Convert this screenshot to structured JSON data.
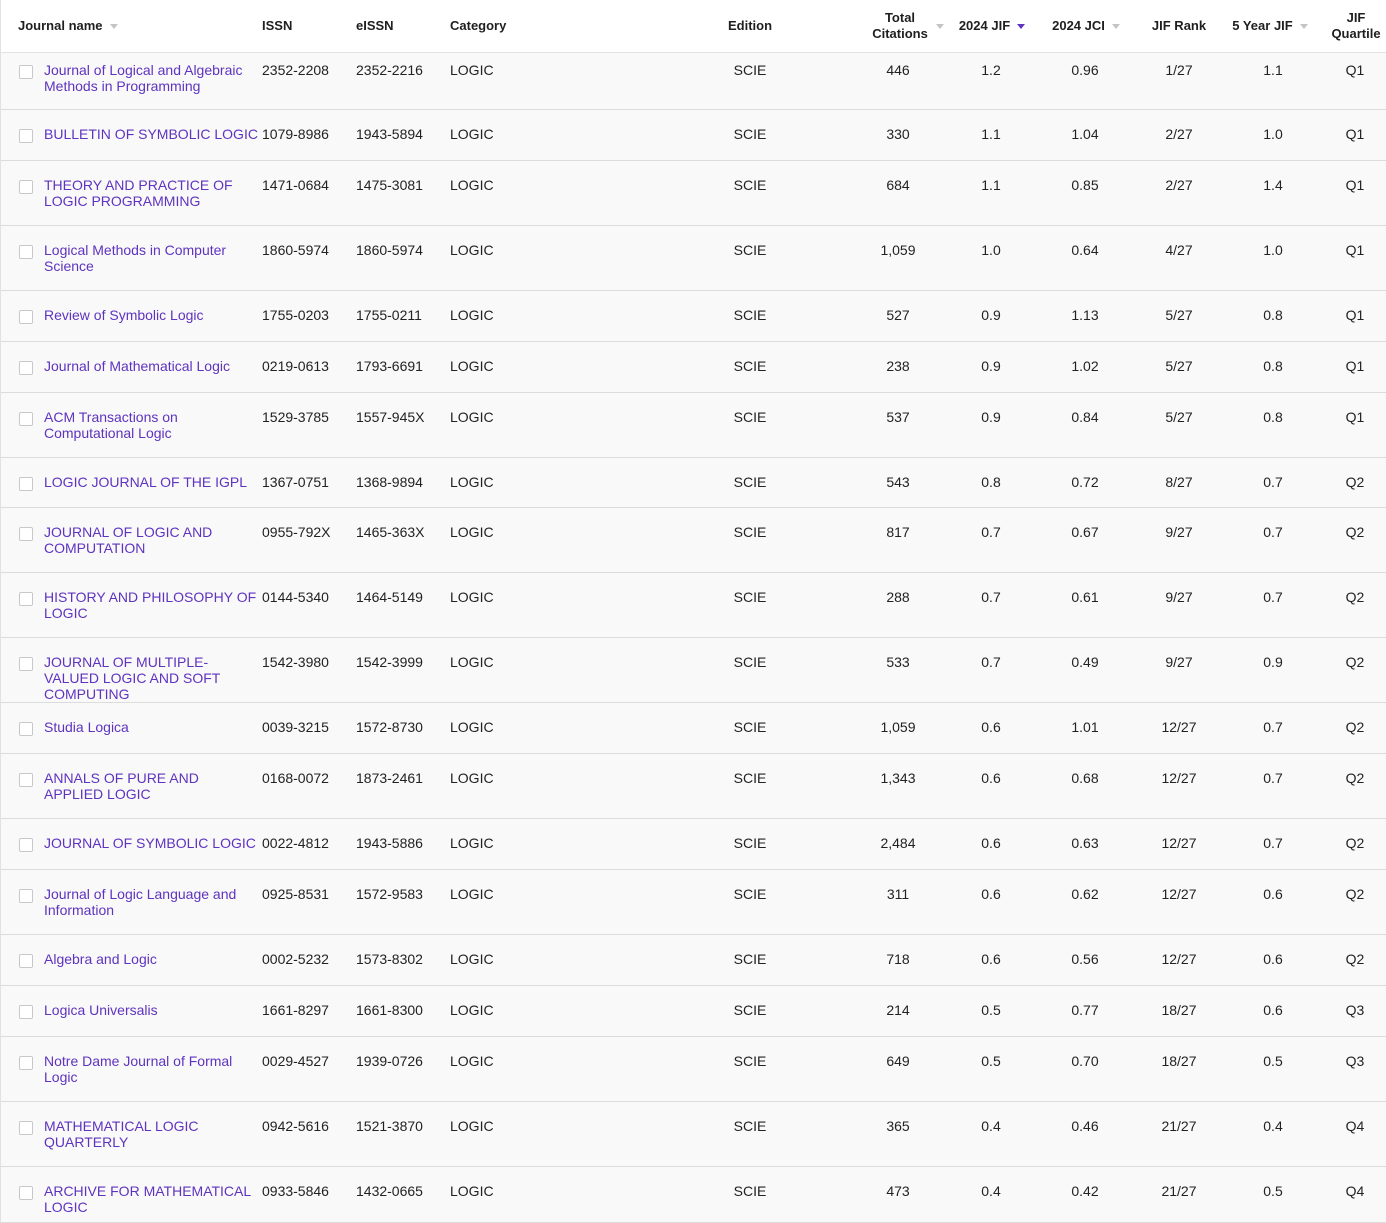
{
  "columns": {
    "journal_name": "Journal name",
    "issn": "ISSN",
    "eissn": "eISSN",
    "category": "Category",
    "edition": "Edition",
    "total_citations": "Total Citations",
    "jif": "2024 JIF",
    "jci": "2024 JCI",
    "jif_rank": "JIF Rank",
    "five_year_jif": "5 Year JIF",
    "jif_quartile": "JIF Quartile"
  },
  "rows": [
    {
      "name": "Journal of Logical and Algebraic Methods in Programming",
      "issn": "2352-2208",
      "eissn": "2352-2216",
      "category": "LOGIC",
      "edition": "SCIE",
      "citations": "446",
      "jif": "1.2",
      "jci": "0.96",
      "rank": "1/27",
      "jif5": "1.1",
      "quartile": "Q1"
    },
    {
      "name": "BULLETIN OF SYMBOLIC LOGIC",
      "issn": "1079-8986",
      "eissn": "1943-5894",
      "category": "LOGIC",
      "edition": "SCIE",
      "citations": "330",
      "jif": "1.1",
      "jci": "1.04",
      "rank": "2/27",
      "jif5": "1.0",
      "quartile": "Q1"
    },
    {
      "name": "THEORY AND PRACTICE OF LOGIC PROGRAMMING",
      "issn": "1471-0684",
      "eissn": "1475-3081",
      "category": "LOGIC",
      "edition": "SCIE",
      "citations": "684",
      "jif": "1.1",
      "jci": "0.85",
      "rank": "2/27",
      "jif5": "1.4",
      "quartile": "Q1"
    },
    {
      "name": "Logical Methods in Computer Science",
      "issn": "1860-5974",
      "eissn": "1860-5974",
      "category": "LOGIC",
      "edition": "SCIE",
      "citations": "1,059",
      "jif": "1.0",
      "jci": "0.64",
      "rank": "4/27",
      "jif5": "1.0",
      "quartile": "Q1"
    },
    {
      "name": "Review of Symbolic Logic",
      "issn": "1755-0203",
      "eissn": "1755-0211",
      "category": "LOGIC",
      "edition": "SCIE",
      "citations": "527",
      "jif": "0.9",
      "jci": "1.13",
      "rank": "5/27",
      "jif5": "0.8",
      "quartile": "Q1"
    },
    {
      "name": "Journal of Mathematical Logic",
      "issn": "0219-0613",
      "eissn": "1793-6691",
      "category": "LOGIC",
      "edition": "SCIE",
      "citations": "238",
      "jif": "0.9",
      "jci": "1.02",
      "rank": "5/27",
      "jif5": "0.8",
      "quartile": "Q1"
    },
    {
      "name": "ACM Transactions on Computational Logic",
      "issn": "1529-3785",
      "eissn": "1557-945X",
      "category": "LOGIC",
      "edition": "SCIE",
      "citations": "537",
      "jif": "0.9",
      "jci": "0.84",
      "rank": "5/27",
      "jif5": "0.8",
      "quartile": "Q1"
    },
    {
      "name": "LOGIC JOURNAL OF THE IGPL",
      "issn": "1367-0751",
      "eissn": "1368-9894",
      "category": "LOGIC",
      "edition": "SCIE",
      "citations": "543",
      "jif": "0.8",
      "jci": "0.72",
      "rank": "8/27",
      "jif5": "0.7",
      "quartile": "Q2"
    },
    {
      "name": "JOURNAL OF LOGIC AND COMPUTATION",
      "issn": "0955-792X",
      "eissn": "1465-363X",
      "category": "LOGIC",
      "edition": "SCIE",
      "citations": "817",
      "jif": "0.7",
      "jci": "0.67",
      "rank": "9/27",
      "jif5": "0.7",
      "quartile": "Q2"
    },
    {
      "name": "HISTORY AND PHILOSOPHY OF LOGIC",
      "issn": "0144-5340",
      "eissn": "1464-5149",
      "category": "LOGIC",
      "edition": "SCIE",
      "citations": "288",
      "jif": "0.7",
      "jci": "0.61",
      "rank": "9/27",
      "jif5": "0.7",
      "quartile": "Q2"
    },
    {
      "name": "JOURNAL OF MULTIPLE-VALUED LOGIC AND SOFT COMPUTING",
      "issn": "1542-3980",
      "eissn": "1542-3999",
      "category": "LOGIC",
      "edition": "SCIE",
      "citations": "533",
      "jif": "0.7",
      "jci": "0.49",
      "rank": "9/27",
      "jif5": "0.9",
      "quartile": "Q2"
    },
    {
      "name": "Studia Logica",
      "issn": "0039-3215",
      "eissn": "1572-8730",
      "category": "LOGIC",
      "edition": "SCIE",
      "citations": "1,059",
      "jif": "0.6",
      "jci": "1.01",
      "rank": "12/27",
      "jif5": "0.7",
      "quartile": "Q2"
    },
    {
      "name": "ANNALS OF PURE AND APPLIED LOGIC",
      "issn": "0168-0072",
      "eissn": "1873-2461",
      "category": "LOGIC",
      "edition": "SCIE",
      "citations": "1,343",
      "jif": "0.6",
      "jci": "0.68",
      "rank": "12/27",
      "jif5": "0.7",
      "quartile": "Q2"
    },
    {
      "name": "JOURNAL OF SYMBOLIC LOGIC",
      "issn": "0022-4812",
      "eissn": "1943-5886",
      "category": "LOGIC",
      "edition": "SCIE",
      "citations": "2,484",
      "jif": "0.6",
      "jci": "0.63",
      "rank": "12/27",
      "jif5": "0.7",
      "quartile": "Q2"
    },
    {
      "name": "Journal of Logic Language and Information",
      "issn": "0925-8531",
      "eissn": "1572-9583",
      "category": "LOGIC",
      "edition": "SCIE",
      "citations": "311",
      "jif": "0.6",
      "jci": "0.62",
      "rank": "12/27",
      "jif5": "0.6",
      "quartile": "Q2"
    },
    {
      "name": "Algebra and Logic",
      "issn": "0002-5232",
      "eissn": "1573-8302",
      "category": "LOGIC",
      "edition": "SCIE",
      "citations": "718",
      "jif": "0.6",
      "jci": "0.56",
      "rank": "12/27",
      "jif5": "0.6",
      "quartile": "Q2"
    },
    {
      "name": "Logica Universalis",
      "issn": "1661-8297",
      "eissn": "1661-8300",
      "category": "LOGIC",
      "edition": "SCIE",
      "citations": "214",
      "jif": "0.5",
      "jci": "0.77",
      "rank": "18/27",
      "jif5": "0.6",
      "quartile": "Q3"
    },
    {
      "name": "Notre Dame Journal of Formal Logic",
      "issn": "0029-4527",
      "eissn": "1939-0726",
      "category": "LOGIC",
      "edition": "SCIE",
      "citations": "649",
      "jif": "0.5",
      "jci": "0.70",
      "rank": "18/27",
      "jif5": "0.5",
      "quartile": "Q3"
    },
    {
      "name": "MATHEMATICAL LOGIC QUARTERLY",
      "issn": "0942-5616",
      "eissn": "1521-3870",
      "category": "LOGIC",
      "edition": "SCIE",
      "citations": "365",
      "jif": "0.4",
      "jci": "0.46",
      "rank": "21/27",
      "jif5": "0.4",
      "quartile": "Q4"
    },
    {
      "name": "ARCHIVE FOR MATHEMATICAL LOGIC",
      "issn": "0933-5846",
      "eissn": "1432-0665",
      "category": "LOGIC",
      "edition": "SCIE",
      "citations": "473",
      "jif": "0.4",
      "jci": "0.42",
      "rank": "21/27",
      "jif5": "0.5",
      "quartile": "Q4"
    }
  ],
  "colors": {
    "link": "#5e33bf",
    "active_sort": "#5e33bf",
    "row_bg": "#f9f9f9"
  }
}
